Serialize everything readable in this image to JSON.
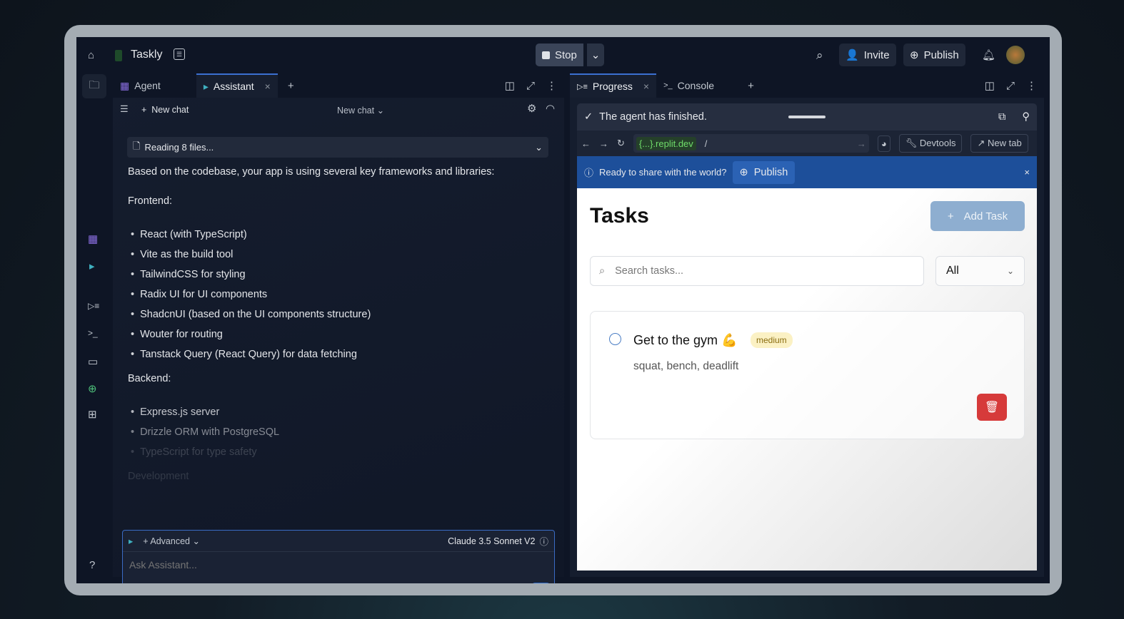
{
  "topbar": {
    "project": "Taskly",
    "stop": "Stop",
    "invite": "Invite",
    "publish": "Publish"
  },
  "left_panel": {
    "tabs": [
      {
        "label": "Agent"
      },
      {
        "label": "Assistant"
      }
    ],
    "new_chat": "New chat",
    "chat_title": "New chat",
    "reading": "Reading 8 files...",
    "intro": "Based on the codebase, your app is using several key frameworks and libraries:",
    "frontend_heading": "Frontend:",
    "frontend": [
      "React (with TypeScript)",
      "Vite as the build tool",
      "TailwindCSS for styling",
      "Radix UI for UI components",
      "ShadcnUI (based on the UI components structure)",
      "Wouter for routing",
      "Tanstack Query (React Query) for data fetching"
    ],
    "backend_heading": "Backend:",
    "backend": [
      "Express.js server",
      "Drizzle ORM with PostgreSQL",
      "TypeScript for type safety"
    ],
    "development_heading": "Development"
  },
  "composer": {
    "advanced": "Advanced",
    "model": "Claude 3.5 Sonnet V2",
    "placeholder": "Ask Assistant..."
  },
  "right_panel": {
    "tabs": [
      {
        "label": "Progress"
      },
      {
        "label": "Console"
      }
    ],
    "status": "The agent has finished.",
    "url_domain": "{...}.replit.dev",
    "url_path": "/",
    "devtools": "Devtools",
    "new_tab": "New tab",
    "banner_text": "Ready to share with the world?",
    "banner_publish": "Publish"
  },
  "app": {
    "title": "Tasks",
    "add_task": "Add Task",
    "search_placeholder": "Search tasks...",
    "filter": "All",
    "task": {
      "title": "Get to the gym 💪",
      "priority": "medium",
      "description": "squat, bench, deadlift"
    }
  }
}
